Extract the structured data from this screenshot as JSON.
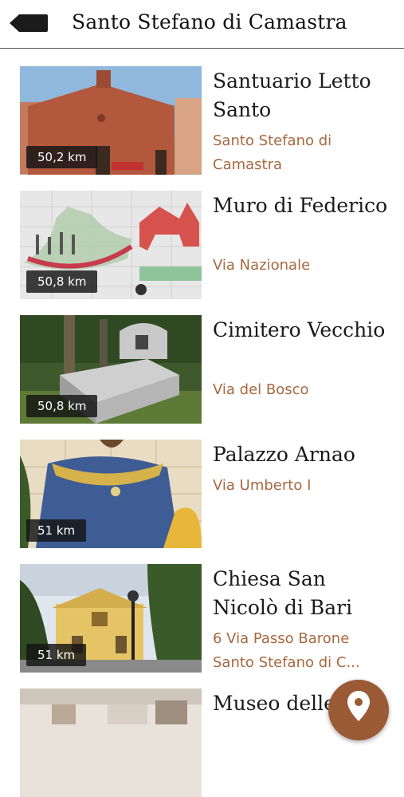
{
  "header": {
    "title": "Santo Stefano di Camastra",
    "back_icon": "back-arrow-icon"
  },
  "places": [
    {
      "name": "Santuario Letto Santo",
      "address": "Santo Stefano di Camastra",
      "distance": "50,2 km"
    },
    {
      "name": "Muro di Federico",
      "address": "Via Nazionale",
      "distance": "50,8 km"
    },
    {
      "name": "Cimitero Vecchio",
      "address": "Via del Bosco",
      "distance": "50,8 km"
    },
    {
      "name": "Palazzo Arnao",
      "address": "Via Umberto I",
      "distance": "51 km"
    },
    {
      "name": "Chiesa San Nicolò di Bari",
      "address": "6 Via Passo Barone Santo Stefano di C...",
      "distance": "51 km"
    },
    {
      "name": "Museo delle",
      "address": "",
      "distance": ""
    }
  ],
  "fab": {
    "icon": "map-pin-icon"
  },
  "colors": {
    "accent": "#a8683f",
    "fab": "#9a5a34"
  }
}
